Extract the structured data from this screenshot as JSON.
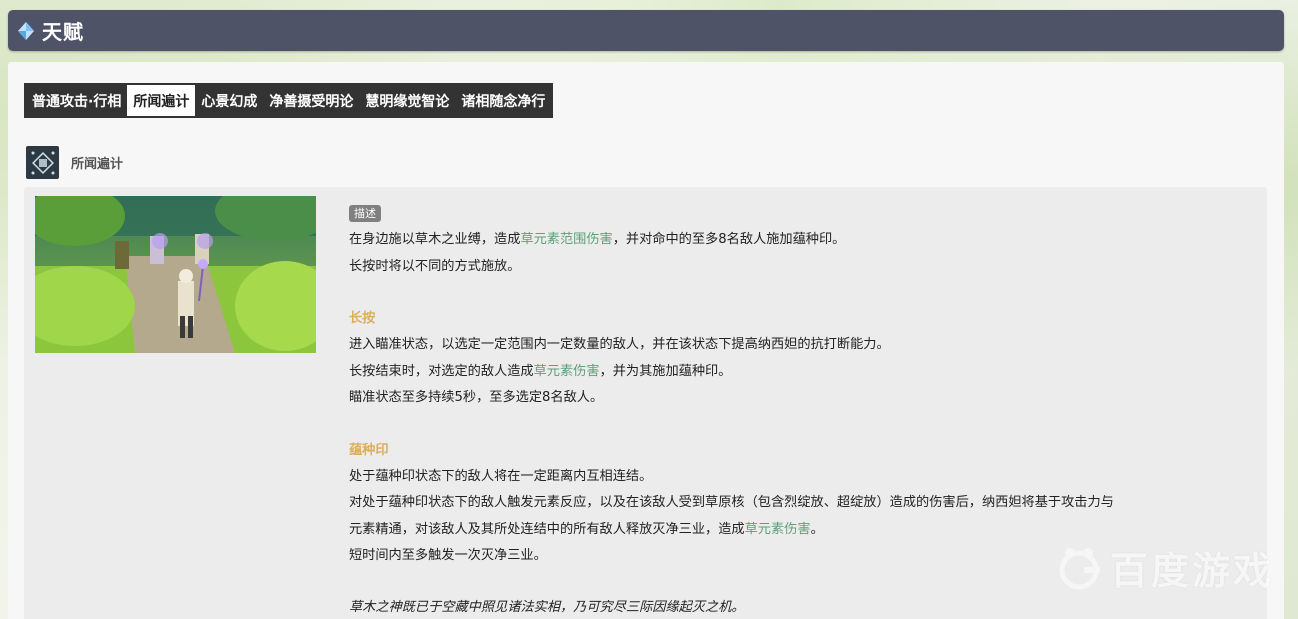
{
  "section_title": "天赋",
  "tabs": [
    "普通攻击·行相",
    "所闻遍计",
    "心景幻成",
    "净善摄受明论",
    "慧明缘觉智论",
    "诸相随念净行"
  ],
  "active_tab_index": 1,
  "skill": {
    "name": "所闻遍计",
    "icon": "skill-icon"
  },
  "desc_badge": "描述",
  "paragraph1": {
    "l1_a": "在身边施以草木之业缚，造成",
    "l1_hl": "草元素范围伤害",
    "l1_b": "，并对命中的至多8名敌人施加蕴种印。",
    "l2": "长按时将以不同的方式施放。"
  },
  "hold": {
    "title": "长按",
    "l1": "进入瞄准状态，以选定一定范围内一定数量的敌人，并在该状态下提高纳西妲的抗打断能力。",
    "l2_a": "长按结束时，对选定的敌人造成",
    "l2_hl": "草元素伤害",
    "l2_b": "，并为其施加蕴种印。",
    "l3": "瞄准状态至多持续5秒，至多选定8名敌人。"
  },
  "seed": {
    "title": "蕴种印",
    "l1": "处于蕴种印状态下的敌人将在一定距离内互相连结。",
    "l2": "对处于蕴种印状态下的敌人触发元素反应，以及在该敌人受到草原核（包含烈绽放、超绽放）造成的伤害后，纳西妲将基于攻击力与",
    "l3_a": "元素精通，对该敌人及其所处连结中的所有敌人释放灭净三业，造成",
    "l3_hl": "草元素伤害",
    "l3_b": "。",
    "l4": "短时间内至多触发一次灭净三业。"
  },
  "quote": "草木之神既已于空藏中照见诸法实相，乃可究尽三际因缘起灭之机。",
  "watermark": "百度游戏",
  "colors": {
    "header_bg": "#4f5367",
    "highlight_green": "#5f9f78",
    "subhead_gold": "#dcae5c",
    "tab_bg": "#333333"
  }
}
